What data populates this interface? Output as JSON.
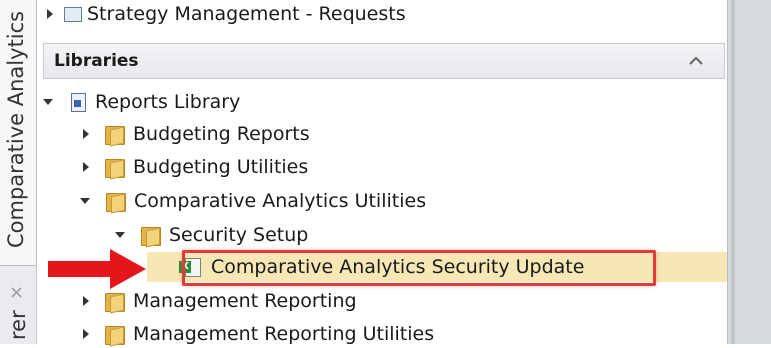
{
  "vtabs": {
    "active_label": "Comparative Analytics",
    "second_label": "rer",
    "second_close": "×"
  },
  "top_item": {
    "label": "Strategy Management - Requests"
  },
  "libraries": {
    "header": "Libraries",
    "collapse_icon": "chevron-up-icon"
  },
  "tree": {
    "reports_library": "Reports Library",
    "budgeting_reports": "Budgeting Reports",
    "budgeting_utilities": "Budgeting Utilities",
    "comparative_analytics_utilities": "Comparative Analytics Utilities",
    "security_setup": "Security Setup",
    "security_update": "Comparative Analytics Security Update",
    "management_reporting": "Management Reporting",
    "management_reporting_utilities": "Management Reporting Utilities"
  },
  "colors": {
    "highlight": "#f6e7b4",
    "annotation_red": "#e13b3b",
    "arrow_red": "#e4151b"
  }
}
